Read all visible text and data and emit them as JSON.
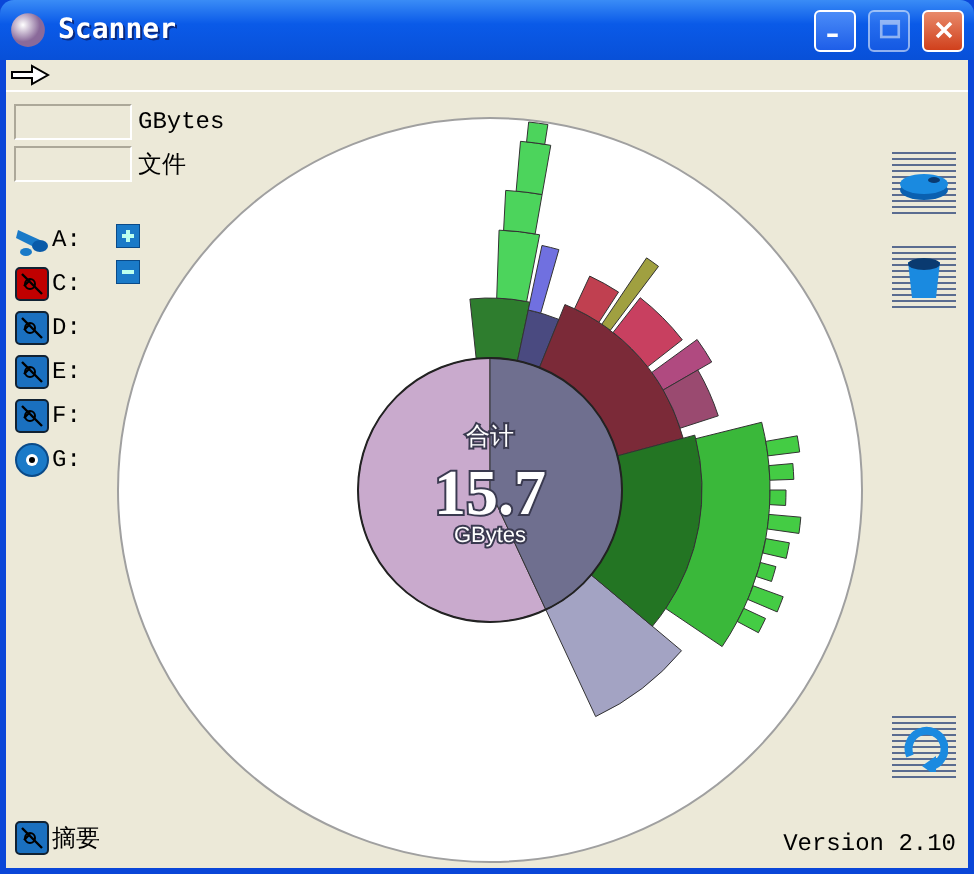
{
  "window": {
    "title": "Scanner"
  },
  "fields": [
    {
      "label": "GBytes"
    },
    {
      "label": "文件"
    }
  ],
  "drives": [
    {
      "label": "A:",
      "kind": "floppy",
      "selected": false
    },
    {
      "label": "C:",
      "kind": "disk",
      "selected": true
    },
    {
      "label": "D:",
      "kind": "disk",
      "selected": false
    },
    {
      "label": "E:",
      "kind": "disk",
      "selected": false
    },
    {
      "label": "F:",
      "kind": "disk",
      "selected": false
    },
    {
      "label": "G:",
      "kind": "cd",
      "selected": false
    }
  ],
  "chart": {
    "total_label": "合计",
    "total": "15.7",
    "unit": "GBytes"
  },
  "summary_button": {
    "label": "摘要"
  },
  "version": "Version 2.10"
}
